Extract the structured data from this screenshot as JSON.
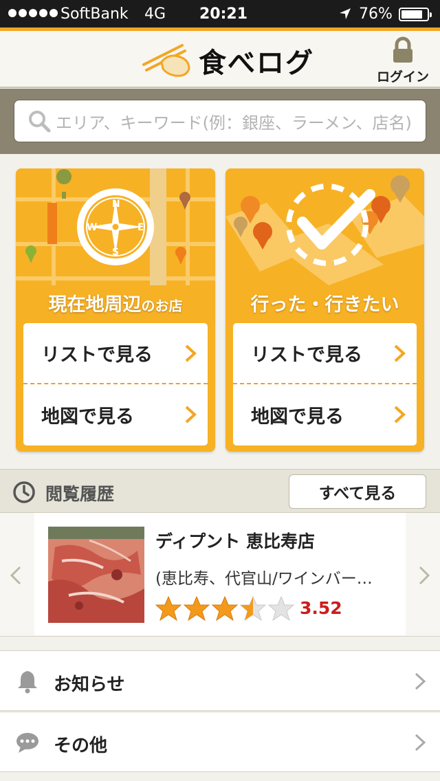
{
  "status_bar": {
    "carrier": "SoftBank",
    "network": "4G",
    "time": "20:21",
    "battery": "76%"
  },
  "header": {
    "logo_text": "食べログ",
    "login_label": "ログイン"
  },
  "search": {
    "placeholder": "エリア、キーワード(例：銀座、ラーメン、店名)"
  },
  "cards": [
    {
      "title_main": "現在地周辺",
      "title_small": "のお店",
      "rows": [
        "リストで見る",
        "地図で見る"
      ]
    },
    {
      "title_main": "行った・行きたい",
      "title_small": "",
      "rows": [
        "リストで見る",
        "地図で見る"
      ]
    }
  ],
  "history": {
    "title": "閲覧履歴",
    "see_all": "すべて見る",
    "item": {
      "name": "ディプント 恵比寿店",
      "area": "(恵比寿、代官山/ワインバー…",
      "rating": "3.52",
      "rating_value": 3.52
    }
  },
  "menu": [
    {
      "label": "お知らせ",
      "icon": "bell-icon"
    },
    {
      "label": "その他",
      "icon": "chat-bubble-icon"
    }
  ],
  "colors": {
    "accent": "#f3a623",
    "card_bg": "#f7b125",
    "rating_red": "#cc1c1c",
    "search_band": "#8a8470"
  }
}
